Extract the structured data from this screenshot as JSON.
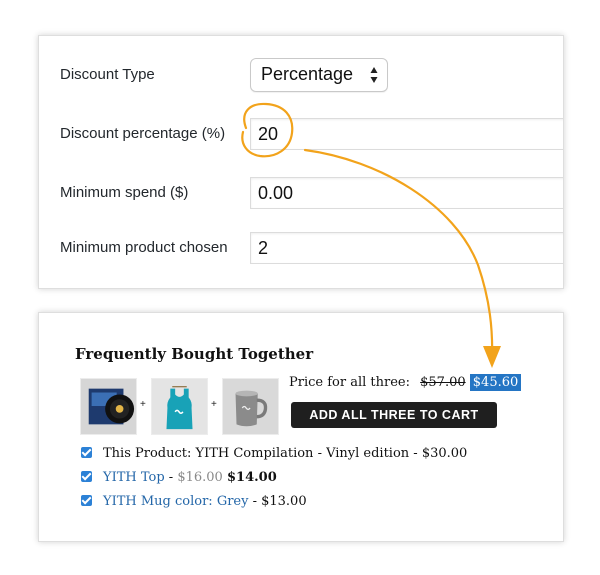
{
  "settings": {
    "discount_type_label": "Discount Type",
    "discount_type_value": "Percentage",
    "discount_percentage_label": "Discount percentage (%)",
    "discount_percentage_value": "20",
    "minimum_spend_label": "Minimum spend ($)",
    "minimum_spend_value": "0.00",
    "minimum_products_label": "Minimum product chosen",
    "minimum_products_value": "2"
  },
  "bundle": {
    "title": "Frequently Bought Together",
    "plus": "+",
    "price_label": "Price for all three:",
    "old_price": "$57.00",
    "new_price": "$45.60",
    "add_button": "ADD ALL THREE TO CART",
    "items": [
      {
        "text": "This Product: YITH Compilation - Vinyl edition - $30.00"
      },
      {
        "name": "YITH Top",
        "sep": " - ",
        "old_price": "$16.00",
        "price": "$14.00"
      },
      {
        "name": "YITH Mug color: Grey",
        "rest": " - $13.00"
      }
    ]
  },
  "colors": {
    "annotation": "#f2a31b",
    "accent": "#2475c4",
    "button": "#1f1f1f"
  },
  "icons": [
    "vinyl-record-thumbnail",
    "tank-top-thumbnail",
    "mug-thumbnail",
    "checkbox-checked-icon",
    "select-arrows-icon"
  ]
}
